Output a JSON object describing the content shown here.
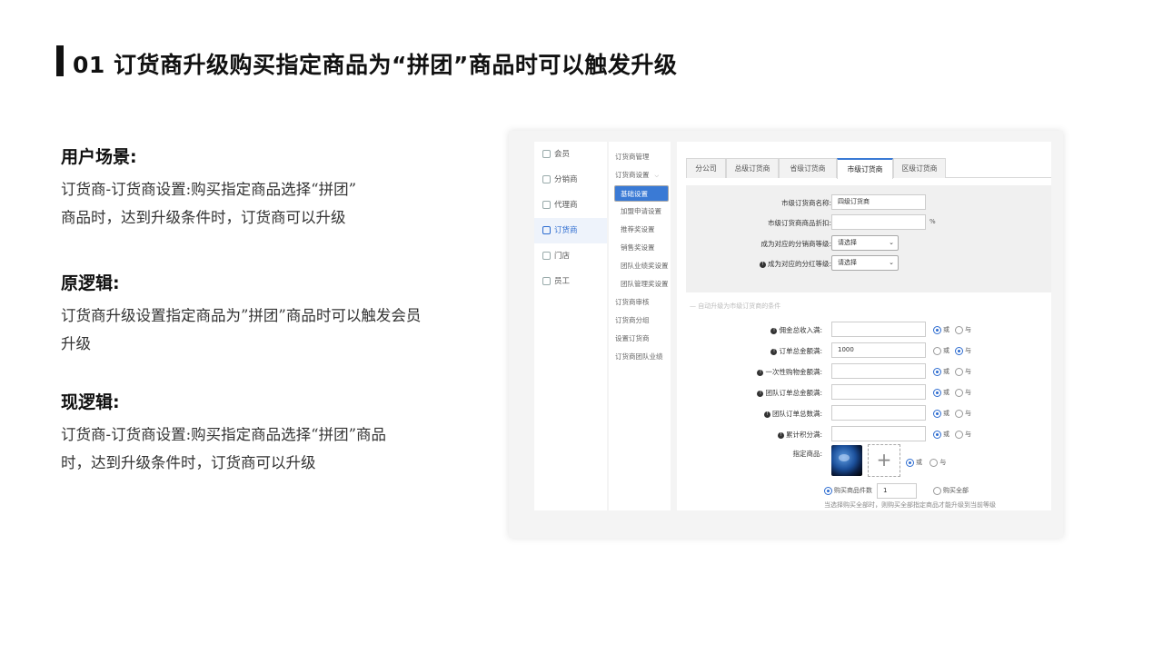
{
  "title": "01 订货商升级购买指定商品为“拼团”商品时可以触发升级",
  "sections": [
    {
      "heading": "用户场景:",
      "lines": [
        "订货商-订货商设置:购买指定商品选择“拼团”",
        "商品时，达到升级条件时，订货商可以升级"
      ]
    },
    {
      "heading": "原逻辑:",
      "lines": [
        "订货商升级设置指定商品为”拼团”商品时可以触发会员",
        "升级"
      ]
    },
    {
      "heading": "现逻辑:",
      "lines": [
        "订货商-订货商设置:购买指定商品选择“拼团”商品",
        "时，达到升级条件时，订货商可以升级"
      ]
    }
  ],
  "screenshot": {
    "nav_primary": [
      "会员",
      "分销商",
      "代理商",
      "订货商",
      "门店",
      "员工"
    ],
    "nav_secondary": {
      "items": [
        "订货商管理",
        "订货商设置",
        "基础设置",
        "加盟申请设置",
        "推荐奖设置",
        "销售奖设置",
        "团队业绩奖设置",
        "团队管理奖设置",
        "订货商审核",
        "订货商分组",
        "设置订货商",
        "订货商团队业绩"
      ],
      "caret": "⌵"
    },
    "tabs": [
      "分公司",
      "总级订货商",
      "省级订货商",
      "市级订货商",
      "区级订货商"
    ],
    "form": {
      "name_label": "市级订货商名称:",
      "name_value": "四级订货商",
      "discount_label": "市级订货商商品折扣:",
      "discount_unit": "%",
      "dist_level_label": "成为对应的分销商等级:",
      "dist_level_value": "请选择",
      "bonus_level_label": "成为对应的分红等级:",
      "bonus_level_value": "请选择",
      "select_arrow": "⌄",
      "section_title": "— 自动升级为市级订货商的条件",
      "info_mark": "!",
      "or_label": "或",
      "and_label": "与",
      "conditions": [
        {
          "label": "佣金总收入满:",
          "value": "",
          "mode": "or"
        },
        {
          "label": "订单总金额满:",
          "value": "1000",
          "mode": "and"
        },
        {
          "label": "一次性购物金额满:",
          "value": "",
          "mode": "or"
        },
        {
          "label": "团队订单总金额满:",
          "value": "",
          "mode": "or"
        },
        {
          "label": "团队订单总数满:",
          "value": "",
          "mode": "or"
        },
        {
          "label": "累计积分满:",
          "value": "",
          "mode": "or"
        }
      ],
      "product_label": "指定商品:",
      "add_symbol": "+",
      "qty_label": "购买商品件数",
      "qty_value": "1",
      "buy_all_label": "购买全部",
      "hint": "当选择购买全部时，则购买全部指定商品才能升级到当前等级"
    }
  }
}
